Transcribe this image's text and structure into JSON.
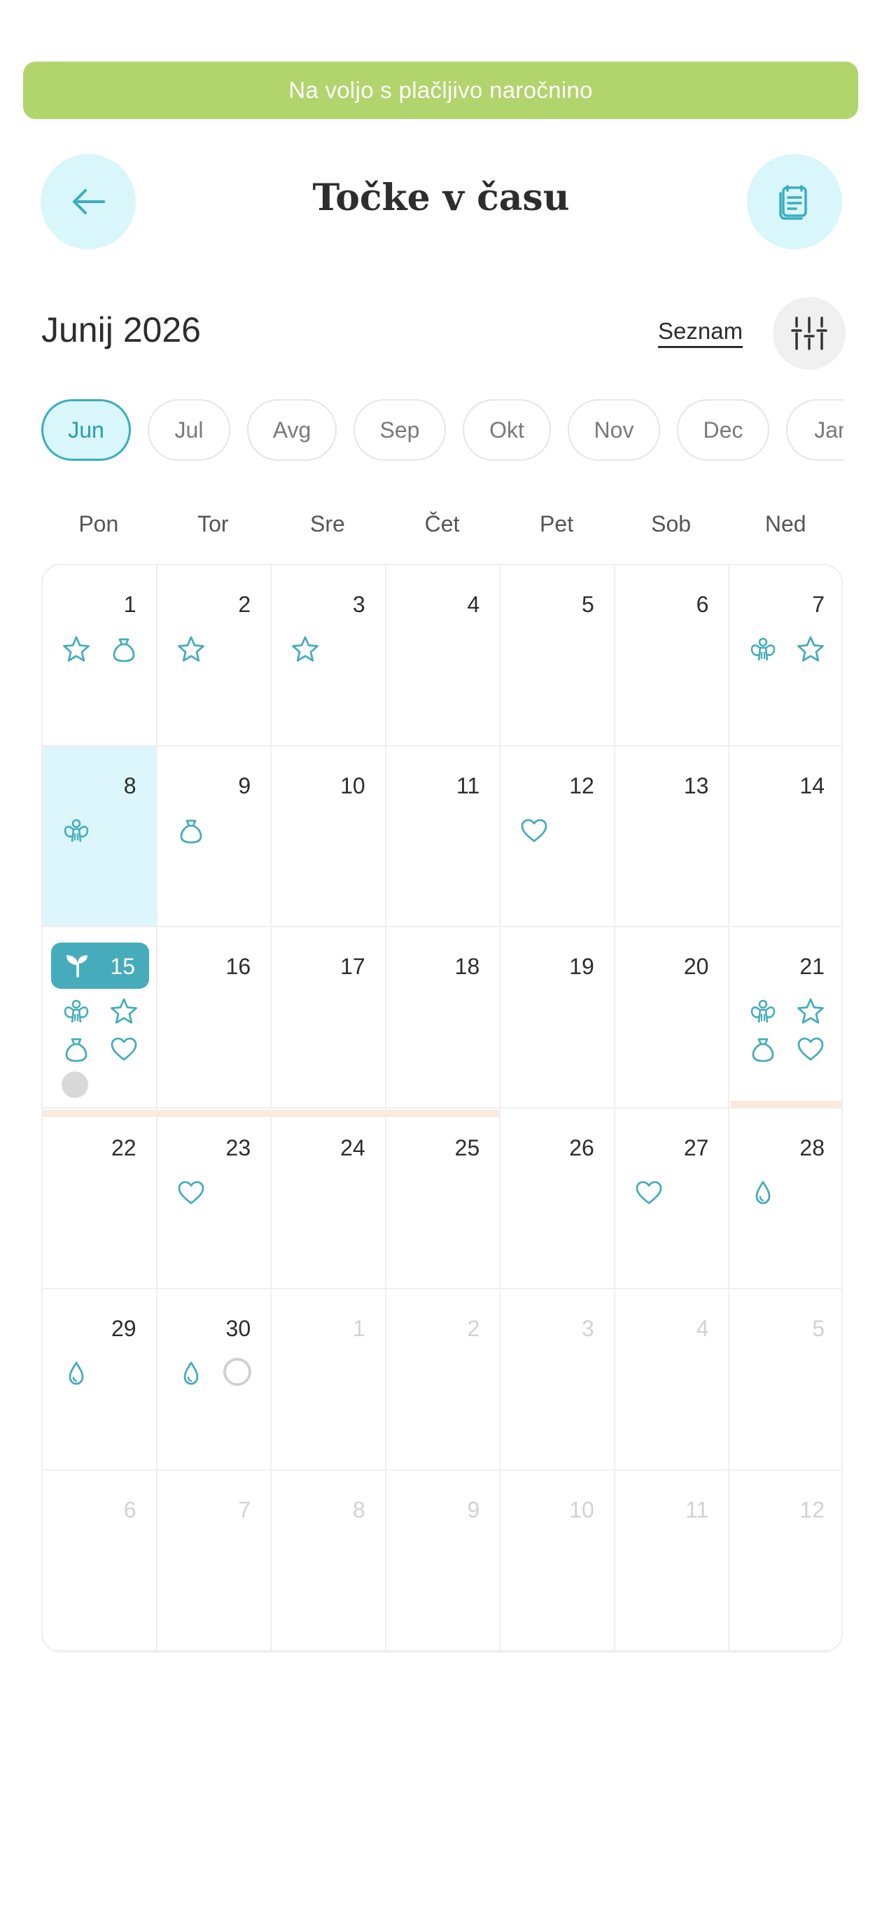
{
  "banner": {
    "text": "Na voljo s plačljivo naročnino"
  },
  "header": {
    "title": "Točke v času",
    "back_icon": "arrow-left-icon",
    "notes_icon": "notes-icon"
  },
  "calendar": {
    "month_title": "Junij 2026",
    "list_label": "Seznam",
    "filter_icon": "sliders-icon",
    "months": [
      "Jun",
      "Jul",
      "Avg",
      "Sep",
      "Okt",
      "Nov",
      "Dec",
      "Jan"
    ],
    "active_month": "Jun",
    "weekdays": [
      "Pon",
      "Tor",
      "Sre",
      "Čet",
      "Pet",
      "Sob",
      "Ned"
    ],
    "days": [
      {
        "n": "1",
        "other": false,
        "icons": [
          "star",
          "bag"
        ]
      },
      {
        "n": "2",
        "other": false,
        "icons": [
          "star"
        ]
      },
      {
        "n": "3",
        "other": false,
        "icons": [
          "star"
        ]
      },
      {
        "n": "4",
        "other": false,
        "icons": []
      },
      {
        "n": "5",
        "other": false,
        "icons": []
      },
      {
        "n": "6",
        "other": false,
        "icons": []
      },
      {
        "n": "7",
        "other": false,
        "icons": [
          "angel",
          "star"
        ]
      },
      {
        "n": "8",
        "other": false,
        "icons": [
          "angel"
        ],
        "highlight": true
      },
      {
        "n": "9",
        "other": false,
        "icons": [
          "bag"
        ]
      },
      {
        "n": "10",
        "other": false,
        "icons": []
      },
      {
        "n": "11",
        "other": false,
        "icons": []
      },
      {
        "n": "12",
        "other": false,
        "icons": [
          "heart"
        ]
      },
      {
        "n": "13",
        "other": false,
        "icons": []
      },
      {
        "n": "14",
        "other": false,
        "icons": []
      },
      {
        "n": "15",
        "other": false,
        "icons": [
          "angel",
          "star",
          "bag",
          "heart"
        ],
        "today": true,
        "dot": "gray"
      },
      {
        "n": "16",
        "other": false,
        "icons": []
      },
      {
        "n": "17",
        "other": false,
        "icons": []
      },
      {
        "n": "18",
        "other": false,
        "icons": []
      },
      {
        "n": "19",
        "other": false,
        "icons": []
      },
      {
        "n": "20",
        "other": false,
        "icons": []
      },
      {
        "n": "21",
        "other": false,
        "icons": [
          "angel",
          "star",
          "bag",
          "heart"
        ]
      },
      {
        "n": "22",
        "other": false,
        "icons": []
      },
      {
        "n": "23",
        "other": false,
        "icons": [
          "heart"
        ]
      },
      {
        "n": "24",
        "other": false,
        "icons": []
      },
      {
        "n": "25",
        "other": false,
        "icons": []
      },
      {
        "n": "26",
        "other": false,
        "icons": []
      },
      {
        "n": "27",
        "other": false,
        "icons": [
          "heart"
        ]
      },
      {
        "n": "28",
        "other": false,
        "icons": [
          "drop"
        ]
      },
      {
        "n": "29",
        "other": false,
        "icons": [
          "drop"
        ]
      },
      {
        "n": "30",
        "other": false,
        "icons": [
          "drop"
        ],
        "ring": true
      },
      {
        "n": "1",
        "other": true,
        "icons": []
      },
      {
        "n": "2",
        "other": true,
        "icons": []
      },
      {
        "n": "3",
        "other": true,
        "icons": []
      },
      {
        "n": "4",
        "other": true,
        "icons": []
      },
      {
        "n": "5",
        "other": true,
        "icons": []
      },
      {
        "n": "6",
        "other": true,
        "icons": []
      },
      {
        "n": "7",
        "other": true,
        "icons": []
      },
      {
        "n": "8",
        "other": true,
        "icons": []
      },
      {
        "n": "9",
        "other": true,
        "icons": []
      },
      {
        "n": "10",
        "other": true,
        "icons": []
      },
      {
        "n": "11",
        "other": true,
        "icons": []
      },
      {
        "n": "12",
        "other": true,
        "icons": []
      }
    ]
  },
  "colors": {
    "accent": "#46acbc",
    "banner": "#b1d46d",
    "highlight": "#dcf6fc",
    "peach": "#fbe9dc"
  }
}
